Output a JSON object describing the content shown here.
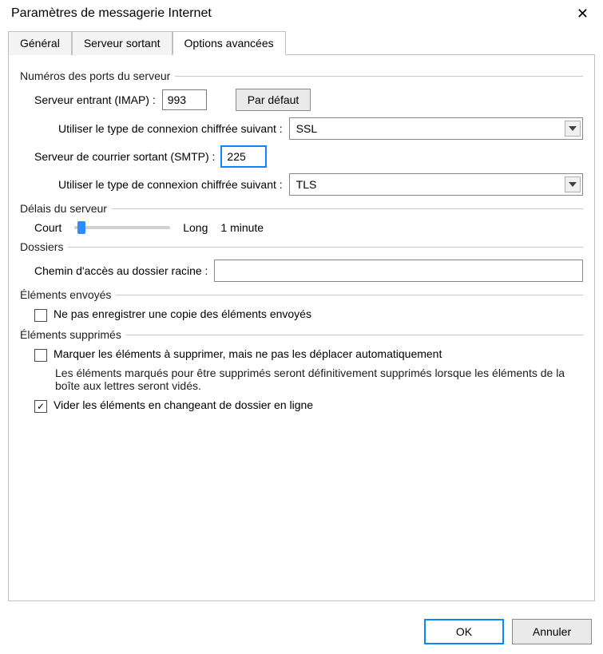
{
  "title": "Paramètres de messagerie Internet",
  "tabs": [
    "Général",
    "Serveur sortant",
    "Options avancées"
  ],
  "active_tab": 2,
  "groups": {
    "ports": {
      "label": "Numéros des ports du serveur",
      "incoming_label": "Serveur entrant (IMAP) :",
      "incoming_value": "993",
      "default_button": "Par défaut",
      "enc_label": "Utiliser le type de connexion chiffrée suivant :",
      "incoming_enc_value": "SSL",
      "outgoing_label": "Serveur de courrier sortant (SMTP) :",
      "outgoing_value": "225",
      "outgoing_enc_value": "TLS"
    },
    "timeouts": {
      "label": "Délais du serveur",
      "short": "Court",
      "long": "Long",
      "value_text": "1 minute"
    },
    "folders": {
      "label": "Dossiers",
      "root_path_label": "Chemin d'accès au dossier racine :",
      "root_path_value": ""
    },
    "sent": {
      "label": "Éléments envoyés",
      "no_copy_label": "Ne pas enregistrer une copie des éléments envoyés",
      "no_copy_checked": false
    },
    "deleted": {
      "label": "Éléments supprimés",
      "mark_label": "Marquer les éléments à supprimer, mais ne pas les déplacer automatiquement",
      "mark_checked": false,
      "mark_help": "Les éléments marqués pour être supprimés seront définitivement supprimés lorsque les éléments de la boîte aux lettres seront vidés.",
      "purge_label": "Vider les éléments en changeant de dossier en ligne",
      "purge_checked": true
    }
  },
  "buttons": {
    "ok": "OK",
    "cancel": "Annuler"
  }
}
